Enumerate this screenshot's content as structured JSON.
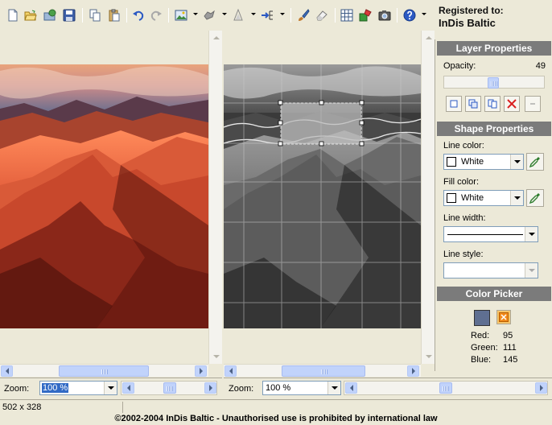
{
  "registration": {
    "label": "Registered to:",
    "name": "InDis Baltic"
  },
  "toolbar": {
    "icons": [
      "new-file-icon",
      "open-folder-icon",
      "open-recent-icon",
      "save-icon",
      "copy-icon",
      "paste-icon",
      "undo-icon",
      "redo-icon",
      "image-icon",
      "layers-icon",
      "filter-icon",
      "align-icon",
      "brush-icon",
      "eraser-icon",
      "grid-icon",
      "effects-icon",
      "camera-icon",
      "help-icon"
    ]
  },
  "layer_properties": {
    "header": "Layer Properties",
    "opacity_label": "Opacity:",
    "opacity_value": "49",
    "opacity_fraction": 0.49
  },
  "shape_properties": {
    "header": "Shape Properties",
    "line_color_label": "Line color:",
    "line_color_value": "White",
    "fill_color_label": "Fill color:",
    "fill_color_value": "White",
    "line_width_label": "Line width:",
    "line_style_label": "Line style:"
  },
  "color_picker": {
    "header": "Color Picker",
    "swatch_color": "#5f6f91",
    "red_label": "Red:",
    "red_value": "95",
    "green_label": "Green:",
    "green_value": "111",
    "blue_label": "Blue:",
    "blue_value": "145"
  },
  "left_view": {
    "zoom_label": "Zoom:",
    "zoom_value": "100 %"
  },
  "right_view": {
    "zoom_label": "Zoom:",
    "zoom_value": "100 %"
  },
  "status": {
    "image_size": "502 x 328",
    "copyright": "©2002-2004 InDis Baltic - Unauthorised use is prohibited by international law"
  },
  "colors": {
    "accent": "#c1d3fb",
    "panel_header": "#7b7b7b",
    "background": "#ece9d8"
  }
}
